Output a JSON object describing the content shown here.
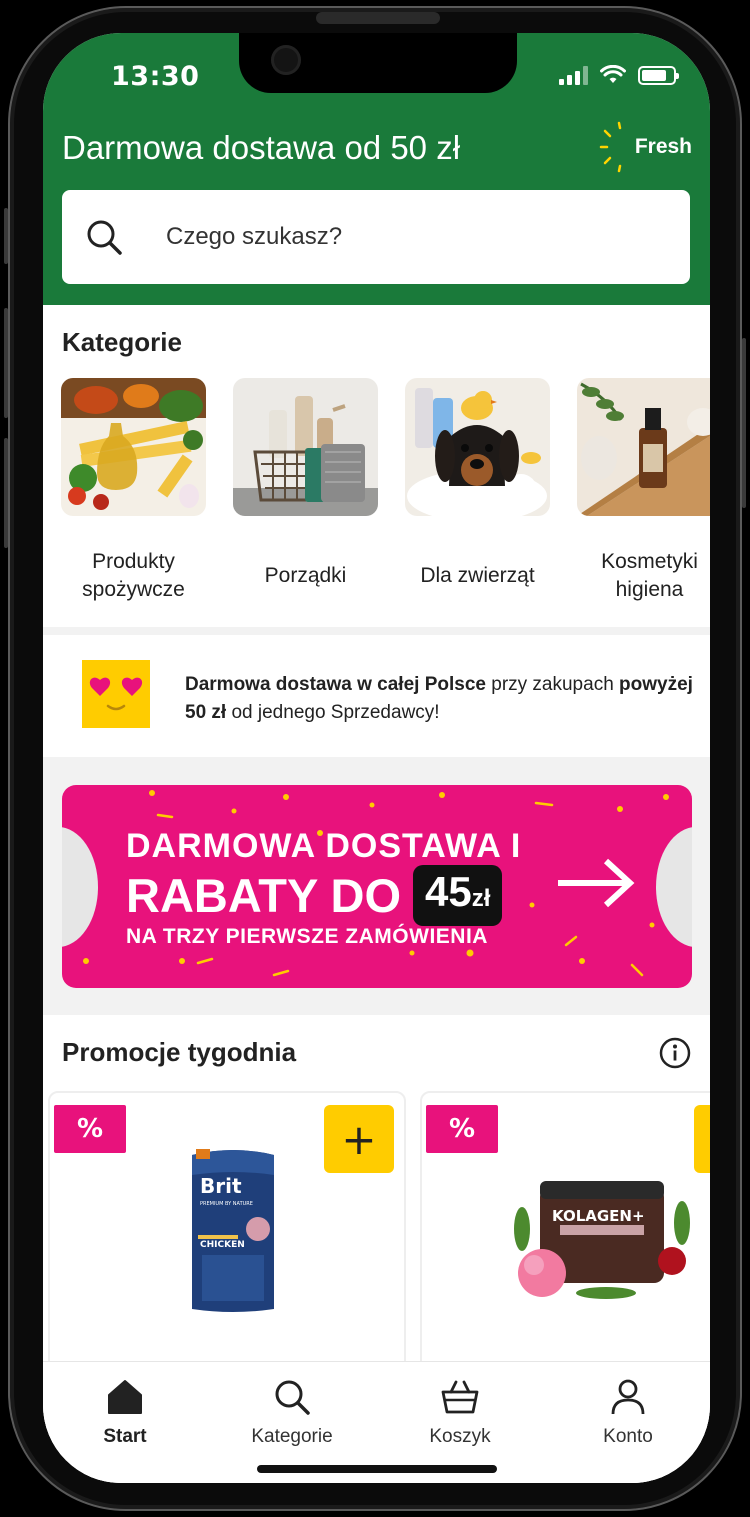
{
  "status": {
    "time": "13:30"
  },
  "header": {
    "promo": "Darmowa dostawa od 50 zł",
    "logo_text": "Fresh",
    "brand_color": "#1a7a3a"
  },
  "search": {
    "placeholder": "Czego szukasz?"
  },
  "categories": {
    "title": "Kategorie",
    "items": [
      {
        "label": "Produkty spożywcze"
      },
      {
        "label": "Porządki"
      },
      {
        "label": "Dla zwierząt"
      },
      {
        "label": "Kosmetyki higiena"
      }
    ]
  },
  "info": {
    "bold1": "Darmowa dostawa w całej Polsce",
    "text1": " przy zakupach ",
    "bold2": "powyżej 50 zł",
    "text2": " od jednego Sprzedawcy!"
  },
  "banner": {
    "line1": "DARMOWA DOSTAWA I",
    "line2": "RABATY DO",
    "amount": "45",
    "currency": "zł",
    "line3": "NA TRZY PIERWSZE ZAMÓWIENIA",
    "color": "#e8127c"
  },
  "promotions": {
    "title": "Promocje tygodnia",
    "badge": "%",
    "add_label": "+",
    "products": [
      {
        "name": "Brit",
        "tagline": "PREMIUM BY NATURE",
        "flavor": "CHICKEN"
      },
      {
        "name": "KOLAGEN+"
      }
    ]
  },
  "tabbar": {
    "items": [
      {
        "label": "Start",
        "icon": "home-icon",
        "active": true
      },
      {
        "label": "Kategorie",
        "icon": "search-icon"
      },
      {
        "label": "Koszyk",
        "icon": "basket-icon"
      },
      {
        "label": "Konto",
        "icon": "user-icon"
      }
    ]
  }
}
